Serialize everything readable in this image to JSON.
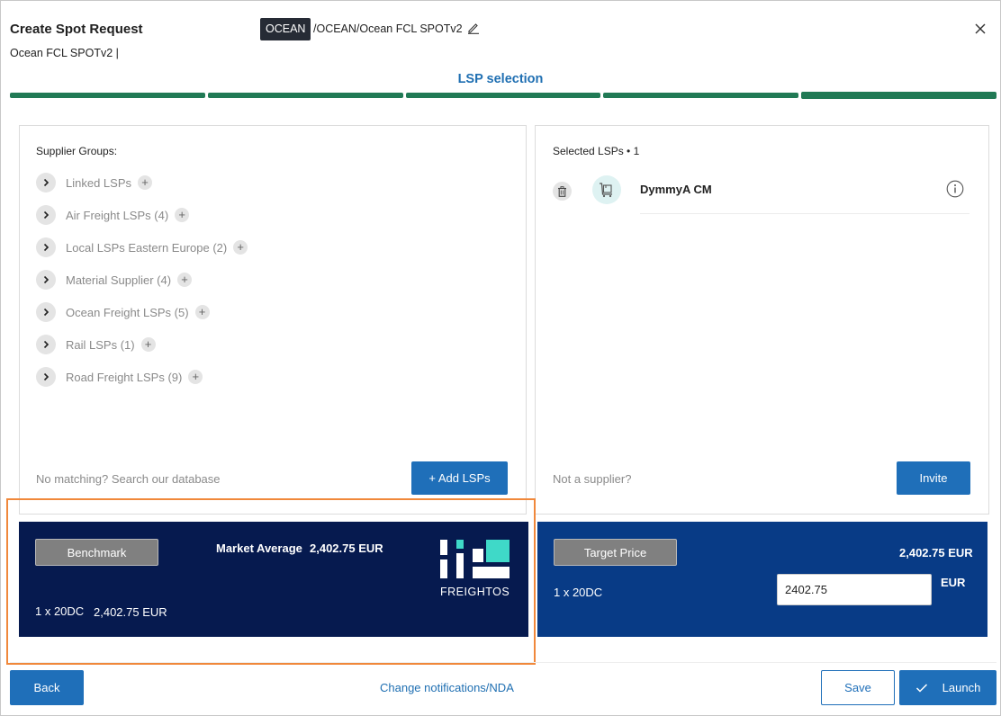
{
  "header": {
    "title": "Create Spot Request",
    "subtitle": "Ocean FCL SPOTv2 |",
    "mode_badge": "OCEAN",
    "path": "/OCEAN/Ocean FCL SPOTv2",
    "edit_icon": "pencil-icon",
    "close_icon": "close-icon"
  },
  "stepper": {
    "title": "LSP selection",
    "steps_total": 5,
    "current_step": 5,
    "color": "#217a55"
  },
  "supplier_groups": {
    "heading": "Supplier Groups:",
    "items": [
      {
        "label": "Linked LSPs"
      },
      {
        "label": "Air Freight LSPs (4)"
      },
      {
        "label": "Local LSPs Eastern Europe (2)"
      },
      {
        "label": "Material Supplier (4)"
      },
      {
        "label": "Ocean Freight LSPs (5)"
      },
      {
        "label": "Rail LSPs (1)"
      },
      {
        "label": "Road Freight LSPs (9)"
      }
    ],
    "footer_text": "No matching? Search our database",
    "add_button": "+ Add LSPs"
  },
  "selected_lsps": {
    "heading": "Selected LSPs • 1",
    "items": [
      {
        "name": "DymmyA CM",
        "icon": "cart-icon"
      }
    ],
    "footer_text": "Not a supplier?",
    "invite_button": "Invite"
  },
  "benchmark": {
    "button": "Benchmark",
    "market_label": "Market Average",
    "market_value": "2,402.75 EUR",
    "container": "1 x 20DC",
    "container_value": "2,402.75 EUR",
    "brand": "FREIGHTOS",
    "bg_color": "#061a4f",
    "accent_color": "#3fd9c8"
  },
  "target": {
    "button": "Target Price",
    "price_display": "2,402.75 EUR",
    "container": "1 x 20DC",
    "input_value": "2402.75",
    "currency": "EUR",
    "bg_color": "#083b86"
  },
  "footer": {
    "back": "Back",
    "link": "Change notifications/NDA",
    "save": "Save",
    "launch": "Launch"
  }
}
